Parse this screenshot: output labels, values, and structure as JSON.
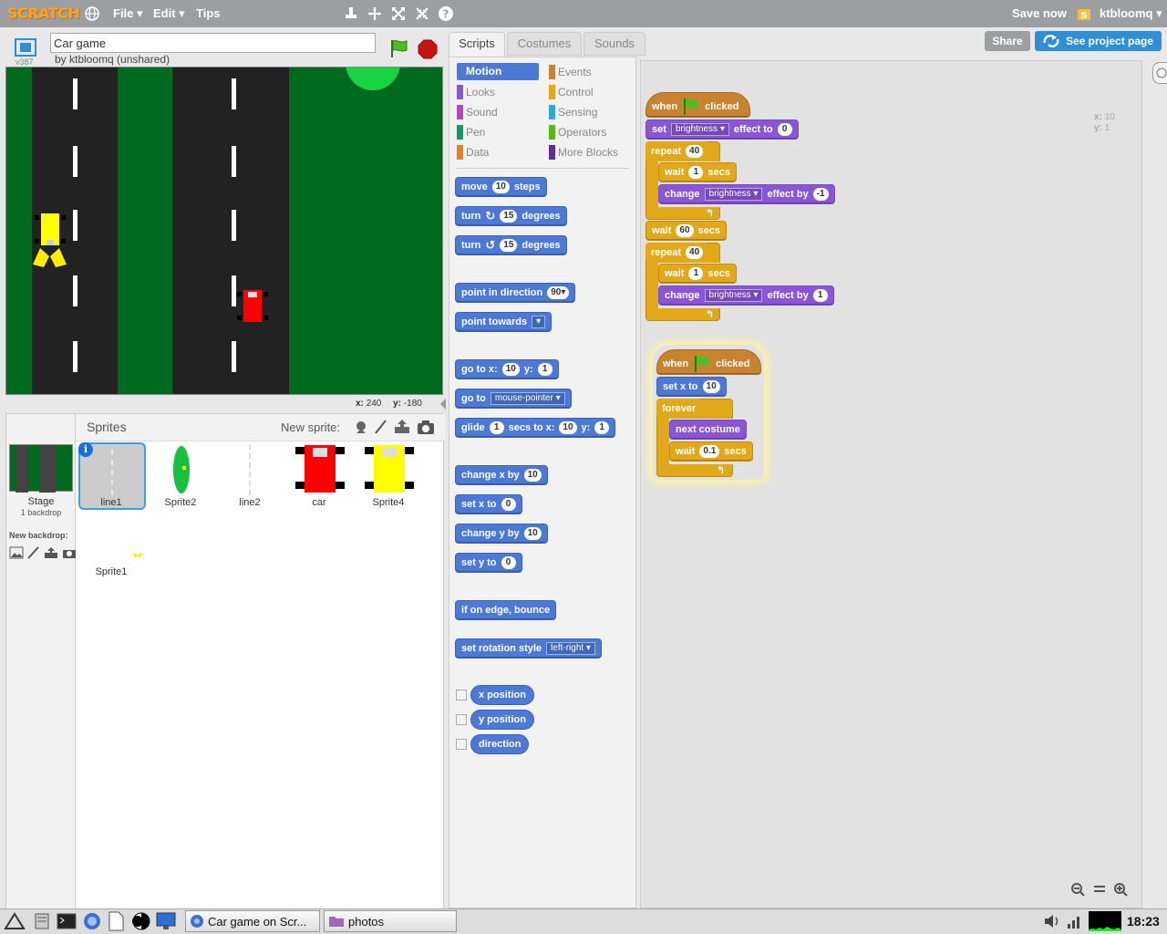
{
  "menubar": {
    "logo": "SCRATCH",
    "file": "File ▾",
    "edit": "Edit ▾",
    "tips": "Tips",
    "save_now": "Save now",
    "user": "ktbloomq ▾"
  },
  "stage": {
    "project_title": "Car game",
    "version": "v387",
    "author": "by ktbloomq (unshared)",
    "mouse_x_label": "x:",
    "mouse_x": "240",
    "mouse_y_label": "y:",
    "mouse_y": "-180"
  },
  "sprites_panel": {
    "title": "Sprites",
    "new_sprite_label": "New sprite:",
    "stage_label": "Stage",
    "stage_backdrops": "1 backdrop",
    "new_backdrop_label": "New backdrop:",
    "sprites": [
      {
        "name": "line1"
      },
      {
        "name": "Sprite2"
      },
      {
        "name": "line2"
      },
      {
        "name": "car"
      },
      {
        "name": "Sprite4"
      },
      {
        "name": "Sprite1"
      }
    ]
  },
  "tabs": {
    "scripts": "Scripts",
    "costumes": "Costumes",
    "sounds": "Sounds"
  },
  "header_buttons": {
    "share": "Share",
    "see_project": "See project page"
  },
  "categories": {
    "motion": "Motion",
    "looks": "Looks",
    "sound": "Sound",
    "pen": "Pen",
    "data": "Data",
    "events": "Events",
    "control": "Control",
    "sensing": "Sensing",
    "operators": "Operators",
    "more": "More Blocks"
  },
  "palette": {
    "move": "move",
    "move_n": "10",
    "steps": "steps",
    "turn": "turn",
    "turn_n": "15",
    "degrees": "degrees",
    "point_in_direction": "point in direction",
    "direction_val": "90▾",
    "point_towards": "point towards",
    "go_to_x": "go to x:",
    "gx": "10",
    "y": "y:",
    "gy": "1",
    "go_to": "go to",
    "mouse_pointer": "mouse-pointer ▾",
    "glide": "glide",
    "glide_n": "1",
    "secs_to_x": "secs to x:",
    "glx": "10",
    "gly": "1",
    "change_x_by": "change x by",
    "cx": "10",
    "set_x_to": "set x to",
    "sx": "0",
    "change_y_by": "change y by",
    "cy": "10",
    "set_y_to": "set y to",
    "sy": "0",
    "bounce": "if on edge, bounce",
    "rotation_style": "set rotation style",
    "rotation_val": "left-right ▾",
    "x_position": "x position",
    "y_position": "y position",
    "direction": "direction"
  },
  "script1": {
    "when": "when",
    "clicked": "clicked",
    "set": "set",
    "brightness": "brightness ▾",
    "effect_to": "effect to",
    "zero": "0",
    "repeat": "repeat",
    "forty": "40",
    "wait": "wait",
    "one": "1",
    "secs": "secs",
    "change": "change",
    "effect_by": "effect by",
    "neg_one": "-1",
    "sixty": "60",
    "pos_one": "1"
  },
  "script2": {
    "when": "when",
    "clicked": "clicked",
    "set_x_to": "set x to",
    "ten": "10",
    "forever": "forever",
    "next_costume": "next costume",
    "wait": "wait",
    "point_one": "0.1",
    "secs": "secs"
  },
  "script_area": {
    "x_label": "x:",
    "x_val": "10",
    "y_label": "y:",
    "y_val": "1"
  },
  "taskbar": {
    "win1": "Car game on Scr...",
    "win2": "photos",
    "clock": "18:23"
  },
  "colors": {
    "motion": "#4c78d6",
    "looks": "#8a55d7",
    "control": "#e1a91a",
    "events": "#c88330",
    "grass": "#006a1f",
    "road": "#222222",
    "car_red": "#ff0000",
    "car_yellow": "#ffff00"
  }
}
